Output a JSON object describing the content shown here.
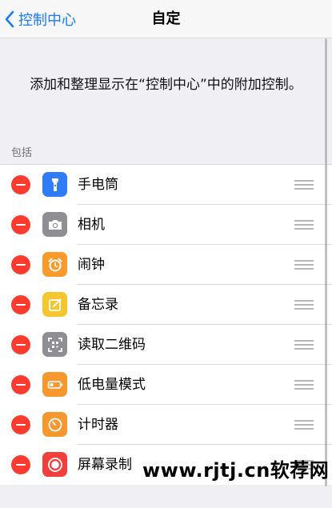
{
  "navbar": {
    "back_label": "控制中心",
    "title": "自定"
  },
  "description": "添加和整理显示在“控制中心”中的附加控制。",
  "section_header": "包括",
  "items": [
    {
      "label": "手电筒",
      "icon": "flashlight-icon",
      "icon_color": "#2f7cf6"
    },
    {
      "label": "相机",
      "icon": "camera-icon",
      "icon_color": "#8e8e93"
    },
    {
      "label": "闹钟",
      "icon": "alarm-clock-icon",
      "icon_color": "#f99a2b"
    },
    {
      "label": "备忘录",
      "icon": "notes-icon",
      "icon_color": "#f7c62f"
    },
    {
      "label": "读取二维码",
      "icon": "qr-code-icon",
      "icon_color": "#8e8e93"
    },
    {
      "label": "低电量模式",
      "icon": "battery-icon",
      "icon_color": "#f7982f"
    },
    {
      "label": "计时器",
      "icon": "timer-icon",
      "icon_color": "#f7982f"
    },
    {
      "label": "屏幕录制",
      "icon": "screen-record-icon",
      "icon_color": "#f23f3b"
    }
  ],
  "watermark": "www.rjtj.cn软荐网",
  "colors": {
    "accent": "#1a7cf5",
    "remove": "#ff3b30",
    "background": "#efeff4"
  }
}
